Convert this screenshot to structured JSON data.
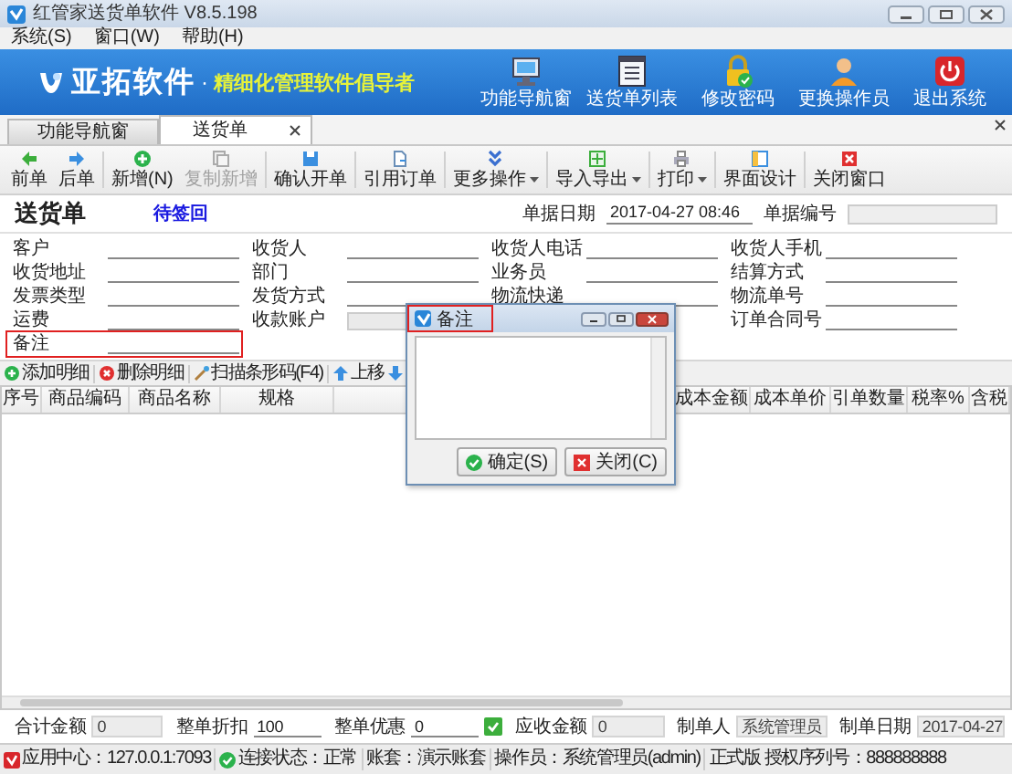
{
  "window": {
    "title": "红管家送货单软件 V8.5.198"
  },
  "menu": [
    "系统(S)",
    "窗口(W)",
    "帮助(H)"
  ],
  "banner": {
    "brand": "亚拓软件",
    "separator": "·",
    "slogan": "精细化管理软件倡导者",
    "actions": [
      "功能导航窗",
      "送货单列表",
      "修改密码",
      "更换操作员",
      "退出系统"
    ]
  },
  "tabs": [
    {
      "label": "功能导航窗",
      "selected": false,
      "closable": false
    },
    {
      "label": "送货单",
      "selected": true,
      "closable": true
    }
  ],
  "toolbar": [
    {
      "label": "前单",
      "disabled": false,
      "dropdown": false
    },
    {
      "label": "后单",
      "disabled": false,
      "dropdown": false
    },
    {
      "label": "新增(N)",
      "disabled": false,
      "dropdown": false
    },
    {
      "label": "复制新增",
      "disabled": true,
      "dropdown": false
    },
    {
      "label": "确认开单",
      "disabled": false,
      "dropdown": false
    },
    {
      "label": "引用订单",
      "disabled": false,
      "dropdown": false
    },
    {
      "label": "更多操作",
      "disabled": false,
      "dropdown": true
    },
    {
      "label": "导入导出",
      "disabled": false,
      "dropdown": true
    },
    {
      "label": "打印",
      "disabled": false,
      "dropdown": true
    },
    {
      "label": "界面设计",
      "disabled": false,
      "dropdown": false
    },
    {
      "label": "关闭窗口",
      "disabled": false,
      "dropdown": false
    }
  ],
  "document": {
    "title": "送货单",
    "status": "待签回",
    "date_label": "单据日期",
    "date": "2017-04-27 08:46",
    "number_label": "单据编号"
  },
  "form_columns": [
    [
      {
        "label": "客户",
        "readonly": false,
        "highlighted": false
      },
      {
        "label": "收货地址",
        "readonly": false,
        "highlighted": false
      },
      {
        "label": "发票类型",
        "readonly": false,
        "highlighted": false
      },
      {
        "label": "运费",
        "readonly": false,
        "highlighted": false
      },
      {
        "label": "备注",
        "readonly": false,
        "highlighted": true
      }
    ],
    [
      {
        "label": "收货人",
        "readonly": false,
        "highlighted": false
      },
      {
        "label": "部门",
        "readonly": false,
        "highlighted": false
      },
      {
        "label": "发货方式",
        "readonly": false,
        "highlighted": false
      },
      {
        "label": "收款账户",
        "readonly": true,
        "highlighted": false
      }
    ],
    [
      {
        "label": "收货人电话",
        "readonly": false,
        "highlighted": false
      },
      {
        "label": "业务员",
        "readonly": false,
        "highlighted": false
      },
      {
        "label": "物流快递",
        "readonly": false,
        "highlighted": false
      }
    ],
    [
      {
        "label": "收货人手机",
        "readonly": false,
        "highlighted": false
      },
      {
        "label": "结算方式",
        "readonly": false,
        "highlighted": false
      },
      {
        "label": "物流单号",
        "readonly": false,
        "highlighted": false
      },
      {
        "label": "订单合同号",
        "readonly": false,
        "highlighted": false
      }
    ]
  ],
  "detail_toolbar": [
    "添加明细",
    "删除明细",
    "扫描条形码(F4)",
    "上移"
  ],
  "table": {
    "columns_left": [
      "序号",
      "商品编码",
      "商品名称",
      "规格"
    ],
    "columns_right": [
      "成本金额",
      "成本单价",
      "引单数量",
      "税率%",
      "含税"
    ]
  },
  "summary": [
    {
      "kind": "field",
      "label": "合计金额",
      "value": "0",
      "readonly": true
    },
    {
      "kind": "field",
      "label": "整单折扣",
      "value": "100",
      "readonly": false
    },
    {
      "kind": "field",
      "label": "整单优惠",
      "value": "0",
      "readonly": false
    },
    {
      "kind": "button"
    },
    {
      "kind": "field",
      "label": "应收金额",
      "value": "0",
      "readonly": true
    },
    {
      "kind": "field",
      "label": "制单人",
      "value": "系统管理员",
      "readonly": true
    },
    {
      "kind": "field",
      "label": "制单日期",
      "value": "2017-04-27",
      "readonly": true
    }
  ],
  "status_bar": [
    "应用中心：127.0.0.1:7093",
    "连接状态：正常",
    "账套：演示账套",
    "操作员：系统管理员(admin)",
    "正式版 授权序列号：888888888"
  ],
  "dialog": {
    "title": "备注",
    "title_highlighted": true,
    "buttons": [
      "确定(S)",
      "关闭(C)"
    ]
  }
}
